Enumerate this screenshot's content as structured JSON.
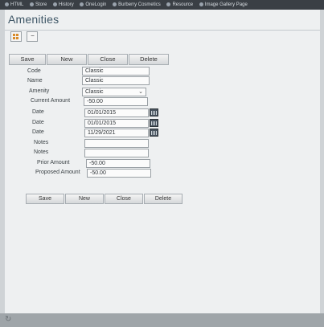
{
  "bookmarks": [
    {
      "label": "HTML"
    },
    {
      "label": "Store"
    },
    {
      "label": "History"
    },
    {
      "label": "OneLogin"
    },
    {
      "label": "Burberry Cosmetics"
    },
    {
      "label": "Resource"
    },
    {
      "label": "Image Gallery Page"
    }
  ],
  "page": {
    "title": "Amenities"
  },
  "toolbar": {
    "save": "Save",
    "new": "New",
    "close": "Close",
    "delete": "Delete",
    "collapse_symbol": "−"
  },
  "form": {
    "code_label": "Code",
    "code_value": "Classic",
    "name_label": "Name",
    "name_value": "Classic",
    "amenity_label": "Amenity",
    "amenity_value": "Classic",
    "current_amount_label": "Current Amount",
    "current_amount_value": "-50.00",
    "date1_label": "Date",
    "date1_value": "01/01/2015",
    "date2_label": "Date",
    "date2_value": "01/01/2015",
    "date3_label": "Date",
    "date3_value": "11/29/2021",
    "notes1_label": "Notes",
    "notes1_value": "",
    "notes2_label": "Notes",
    "notes2_value": "",
    "prior_amount_label": "Prior Amount",
    "prior_amount_value": "-50.00",
    "proposed_amount_label": "Proposed Amount",
    "proposed_amount_value": "-50.00"
  },
  "icons": {
    "grid": "grid-icon",
    "calendar": "calendar-icon",
    "dropdown": "chevron-down-icon",
    "reload": "reload-icon"
  },
  "colors": {
    "title": "#3f5767",
    "accent_icon": "#d88b2b"
  }
}
